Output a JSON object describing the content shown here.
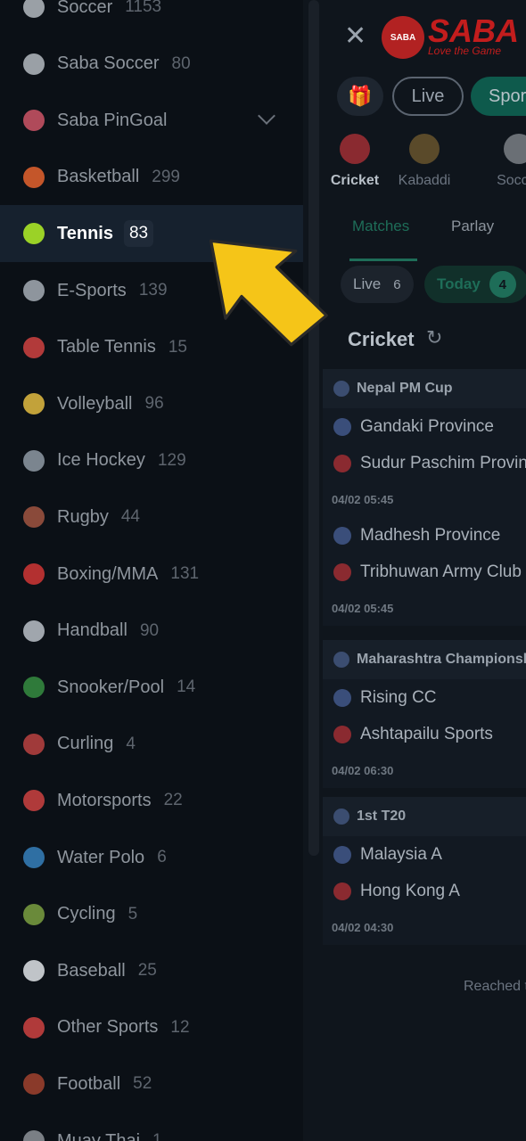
{
  "colors": {
    "background": "#0b1016",
    "active_row": "#16212e",
    "accent_green": "#1e6d58",
    "arrow_yellow": "#f5c518",
    "tennis_ball": "#9bd227"
  },
  "sidebar": {
    "items": [
      {
        "name": "Soccer",
        "count": "1153",
        "icon": "soccer-icon",
        "color": "#9aa0a6"
      },
      {
        "name": "Saba Soccer",
        "count": "80",
        "icon": "saba-soccer-icon",
        "color": "#9aa0a6"
      },
      {
        "name": "Saba PinGoal",
        "count": "",
        "icon": "saba-pingoal-icon",
        "color": "#b04a5a",
        "expandable": true
      },
      {
        "name": "Basketball",
        "count": "299",
        "icon": "basketball-icon",
        "color": "#c4562a"
      },
      {
        "name": "Tennis",
        "count": "83",
        "icon": "tennis-icon",
        "color": "#9bd227",
        "active": true
      },
      {
        "name": "E-Sports",
        "count": "139",
        "icon": "esports-icon",
        "color": "#8e959d"
      },
      {
        "name": "Table Tennis",
        "count": "15",
        "icon": "table-tennis-icon",
        "color": "#b23a3a"
      },
      {
        "name": "Volleyball",
        "count": "96",
        "icon": "volleyball-icon",
        "color": "#c2a23a"
      },
      {
        "name": "Ice Hockey",
        "count": "129",
        "icon": "ice-hockey-icon",
        "color": "#7b858f"
      },
      {
        "name": "Rugby",
        "count": "44",
        "icon": "rugby-icon",
        "color": "#8a4a3a"
      },
      {
        "name": "Boxing/MMA",
        "count": "131",
        "icon": "boxing-icon",
        "color": "#b33030"
      },
      {
        "name": "Handball",
        "count": "90",
        "icon": "handball-icon",
        "color": "#a0a6ad"
      },
      {
        "name": "Snooker/Pool",
        "count": "14",
        "icon": "snooker-icon",
        "color": "#2f7a3a"
      },
      {
        "name": "Curling",
        "count": "4",
        "icon": "curling-icon",
        "color": "#a03a3a"
      },
      {
        "name": "Motorsports",
        "count": "22",
        "icon": "motorsports-icon",
        "color": "#b03a3a"
      },
      {
        "name": "Water Polo",
        "count": "6",
        "icon": "water-polo-icon",
        "color": "#2f6fa3"
      },
      {
        "name": "Cycling",
        "count": "5",
        "icon": "cycling-icon",
        "color": "#6a8a3a"
      },
      {
        "name": "Baseball",
        "count": "25",
        "icon": "baseball-icon",
        "color": "#c0c4c8"
      },
      {
        "name": "Other Sports",
        "count": "12",
        "icon": "other-sports-icon",
        "color": "#b03a3a"
      },
      {
        "name": "Football",
        "count": "52",
        "icon": "football-icon",
        "color": "#8a3a2a"
      },
      {
        "name": "Muay Thai",
        "count": "1",
        "icon": "muay-thai-icon",
        "color": "#7a7f85"
      }
    ]
  },
  "main": {
    "close_icon": "close-icon",
    "logo": {
      "ball": "SABA",
      "text": "SABA",
      "tagline": "Love the Game"
    },
    "gift_icon": "gift-icon",
    "pills": {
      "live": "Live",
      "sports": "Sports"
    },
    "sport_tabs": [
      {
        "label": "Cricket",
        "icon": "cricket-icon",
        "active": true
      },
      {
        "label": "Kabaddi",
        "icon": "kabaddi-icon"
      },
      {
        "label": "Soccer",
        "icon": "soccer-icon"
      }
    ],
    "subtabs": {
      "matches": "Matches",
      "parlay": "Parlay"
    },
    "filters": {
      "live_label": "Live",
      "live_count": "6",
      "today_label": "Today",
      "today_count": "4"
    },
    "section_title": "Cricket",
    "leagues": [
      {
        "name": "Nepal PM Cup",
        "matches": [
          {
            "home": "Gandaki Province",
            "away": "Sudur Paschim Province",
            "time": "04/02 05:45"
          },
          {
            "home": "Madhesh Province",
            "away": "Tribhuwan Army Club",
            "time": "04/02 05:45"
          }
        ]
      },
      {
        "name": "Maharashtra Championship",
        "matches": [
          {
            "home": "Rising CC",
            "away": "Ashtapailu Sports",
            "time": "04/02 06:30"
          }
        ]
      },
      {
        "name": "1st T20",
        "matches": [
          {
            "home": "Malaysia A",
            "away": "Hong Kong A",
            "time": "04/02 04:30"
          }
        ]
      }
    ],
    "reached_text": "Reached the end"
  }
}
